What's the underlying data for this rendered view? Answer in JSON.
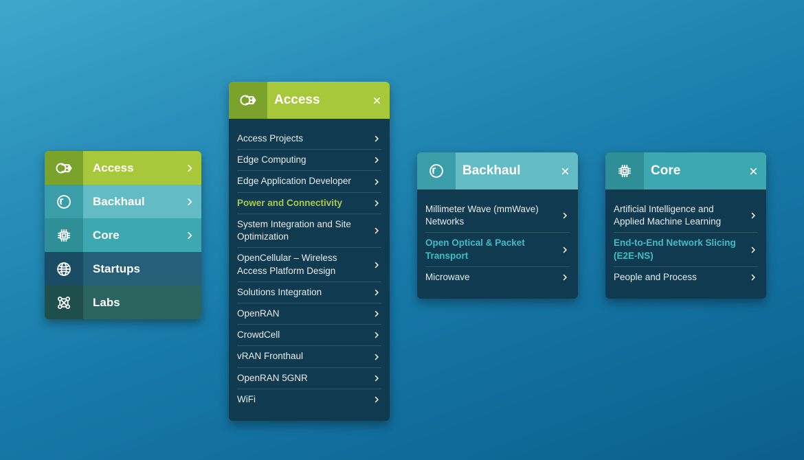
{
  "colors": {
    "access": {
      "dark": "#7ba22a",
      "light": "#a8c83c"
    },
    "backhaul": {
      "dark": "#3a9ea8",
      "light": "#63bcc4"
    },
    "core": {
      "dark": "#2e8f97",
      "light": "#3ea8b0"
    },
    "startups": {
      "dark": "#1a4d63",
      "light": "#265f78"
    },
    "labs": {
      "dark": "#1f4f4a",
      "light": "#2c6560"
    },
    "panelBg": "#0f3a4f"
  },
  "mainNav": {
    "items": [
      {
        "id": "access",
        "label": "Access",
        "hasChevron": true
      },
      {
        "id": "backhaul",
        "label": "Backhaul",
        "hasChevron": true
      },
      {
        "id": "core",
        "label": "Core",
        "hasChevron": true
      },
      {
        "id": "startups",
        "label": "Startups",
        "hasChevron": false
      },
      {
        "id": "labs",
        "label": "Labs",
        "hasChevron": false
      }
    ]
  },
  "panels": {
    "access": {
      "title": "Access",
      "selectedColor": "#aac94a",
      "items": [
        {
          "label": "Access Projects"
        },
        {
          "label": "Edge Computing"
        },
        {
          "label": "Edge Application Developer"
        },
        {
          "label": "Power and Connectivity",
          "selected": true
        },
        {
          "label": "System Integration and Site Optimization"
        },
        {
          "label": "OpenCellular – Wireless Access Platform Design"
        },
        {
          "label": "Solutions Integration"
        },
        {
          "label": "OpenRAN"
        },
        {
          "label": "CrowdCell"
        },
        {
          "label": "vRAN Fronthaul"
        },
        {
          "label": "OpenRAN 5GNR"
        },
        {
          "label": "WiFi"
        }
      ]
    },
    "backhaul": {
      "title": "Backhaul",
      "selectedColor": "#3fbec6",
      "items": [
        {
          "label": "Millimeter Wave (mmWave) Networks"
        },
        {
          "label": "Open Optical & Packet Transport",
          "selected": true
        },
        {
          "label": "Microwave"
        }
      ]
    },
    "core": {
      "title": "Core",
      "selectedColor": "#3fbec6",
      "items": [
        {
          "label": "Artificial Intelligence and Applied Machine Learning"
        },
        {
          "label": "End-to-End Network Slicing (E2E-NS)",
          "selected": true
        },
        {
          "label": "People and Process"
        }
      ]
    }
  },
  "icons": {
    "access": "access",
    "backhaul": "backhaul",
    "core": "core",
    "startups": "globe",
    "labs": "labs"
  }
}
